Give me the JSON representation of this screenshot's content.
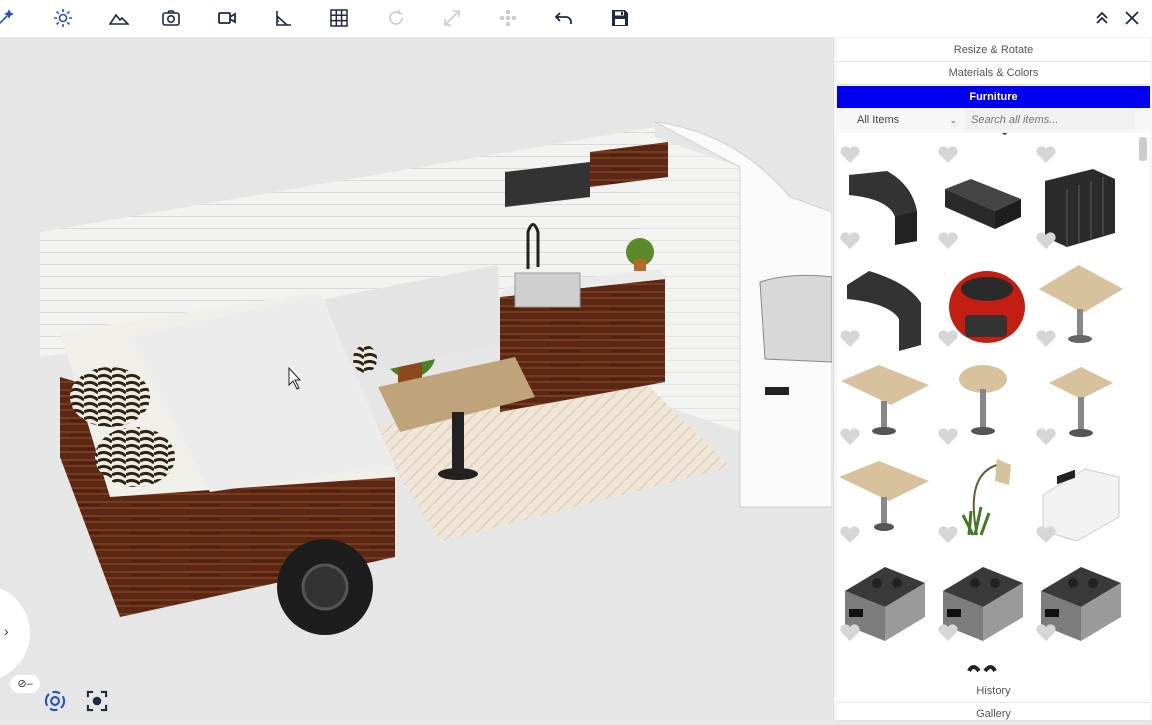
{
  "toolbar": {
    "items": [
      {
        "name": "magic-icon"
      },
      {
        "name": "sun-icon"
      },
      {
        "name": "terrain-icon"
      },
      {
        "name": "camera-icon"
      },
      {
        "name": "video-icon"
      },
      {
        "name": "ruler-angle-icon"
      },
      {
        "name": "grid-icon"
      },
      {
        "name": "rotate-icon",
        "disabled": true
      },
      {
        "name": "resize-icon",
        "disabled": true
      },
      {
        "name": "move-icon",
        "disabled": true
      },
      {
        "name": "undo-icon"
      },
      {
        "name": "save-icon"
      }
    ],
    "collapse_icon": "double-chevron-up-icon",
    "close_icon": "close-icon"
  },
  "panel": {
    "sections": [
      "Resize & Rotate",
      "Materials & Colors",
      "Furniture"
    ],
    "active_section": "Furniture",
    "category_selected": "All Items",
    "search_placeholder": "Search all items...",
    "bottom_sections": [
      "History",
      "Gallery"
    ],
    "items": [
      "bench-l-icon",
      "bench-block-icon",
      "water-tank-icon",
      "bench-l-icon",
      "generator-icon",
      "table-rect-icon",
      "table-rect-icon",
      "table-round-icon",
      "table-square-icon",
      "table-rect-icon",
      "plant-lamp-icon",
      "fridge-icon",
      "cooler-icon",
      "cooler-icon",
      "cooler-icon"
    ]
  },
  "colors": {
    "accent": "#0000ee",
    "dark": "#1f2a44",
    "nav_blue": "#2450c8"
  }
}
